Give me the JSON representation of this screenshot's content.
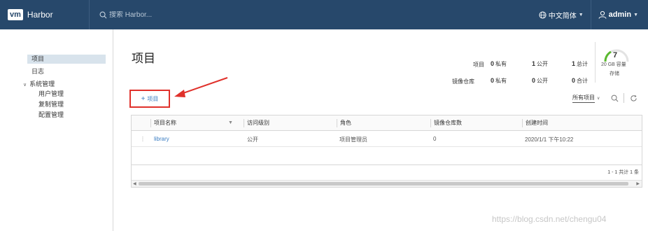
{
  "header": {
    "brand_logo": "vm",
    "brand_name": "Harbor",
    "search_placeholder": "搜索 Harbor...",
    "language": "中文简体",
    "user": "admin",
    "bg_color": "#27486b"
  },
  "sidebar": {
    "items": [
      {
        "label": "项目",
        "active": true
      },
      {
        "label": "日志",
        "active": false
      },
      {
        "label": "系统管理",
        "active": false,
        "expanded": true
      },
      {
        "label": "用户管理",
        "active": false
      },
      {
        "label": "复制管理",
        "active": false
      },
      {
        "label": "配置管理",
        "active": false
      }
    ]
  },
  "main": {
    "title": "项目",
    "stats": {
      "row1_label": "项目",
      "row1_private_num": "0",
      "row1_private_label": "私有",
      "row1_public_num": "1",
      "row1_public_label": "公开",
      "row1_total_num": "1",
      "row1_total_label": "总计",
      "row2_label": "镜像仓库",
      "row2_private_num": "0",
      "row2_private_label": "私有",
      "row2_public_num": "0",
      "row2_public_label": "公开",
      "row2_total_num": "0",
      "row2_total_label": "合计"
    },
    "gauge": {
      "count": "7",
      "capacity": "20 GB 容量",
      "label": "存储"
    },
    "add_button_label": "项目",
    "filter_label": "所有项目",
    "table": {
      "headers": [
        "项目名称",
        "访问级别",
        "角色",
        "镜像仓库数",
        "创建时间"
      ],
      "rows": [
        {
          "name": "library",
          "access": "公开",
          "role": "项目管理员",
          "repo_count": "0",
          "created": "2020/1/1 下午10:22"
        }
      ],
      "pager": "1 - 1 共计 1 条"
    },
    "watermark": "https://blog.csdn.net/chengu04"
  }
}
